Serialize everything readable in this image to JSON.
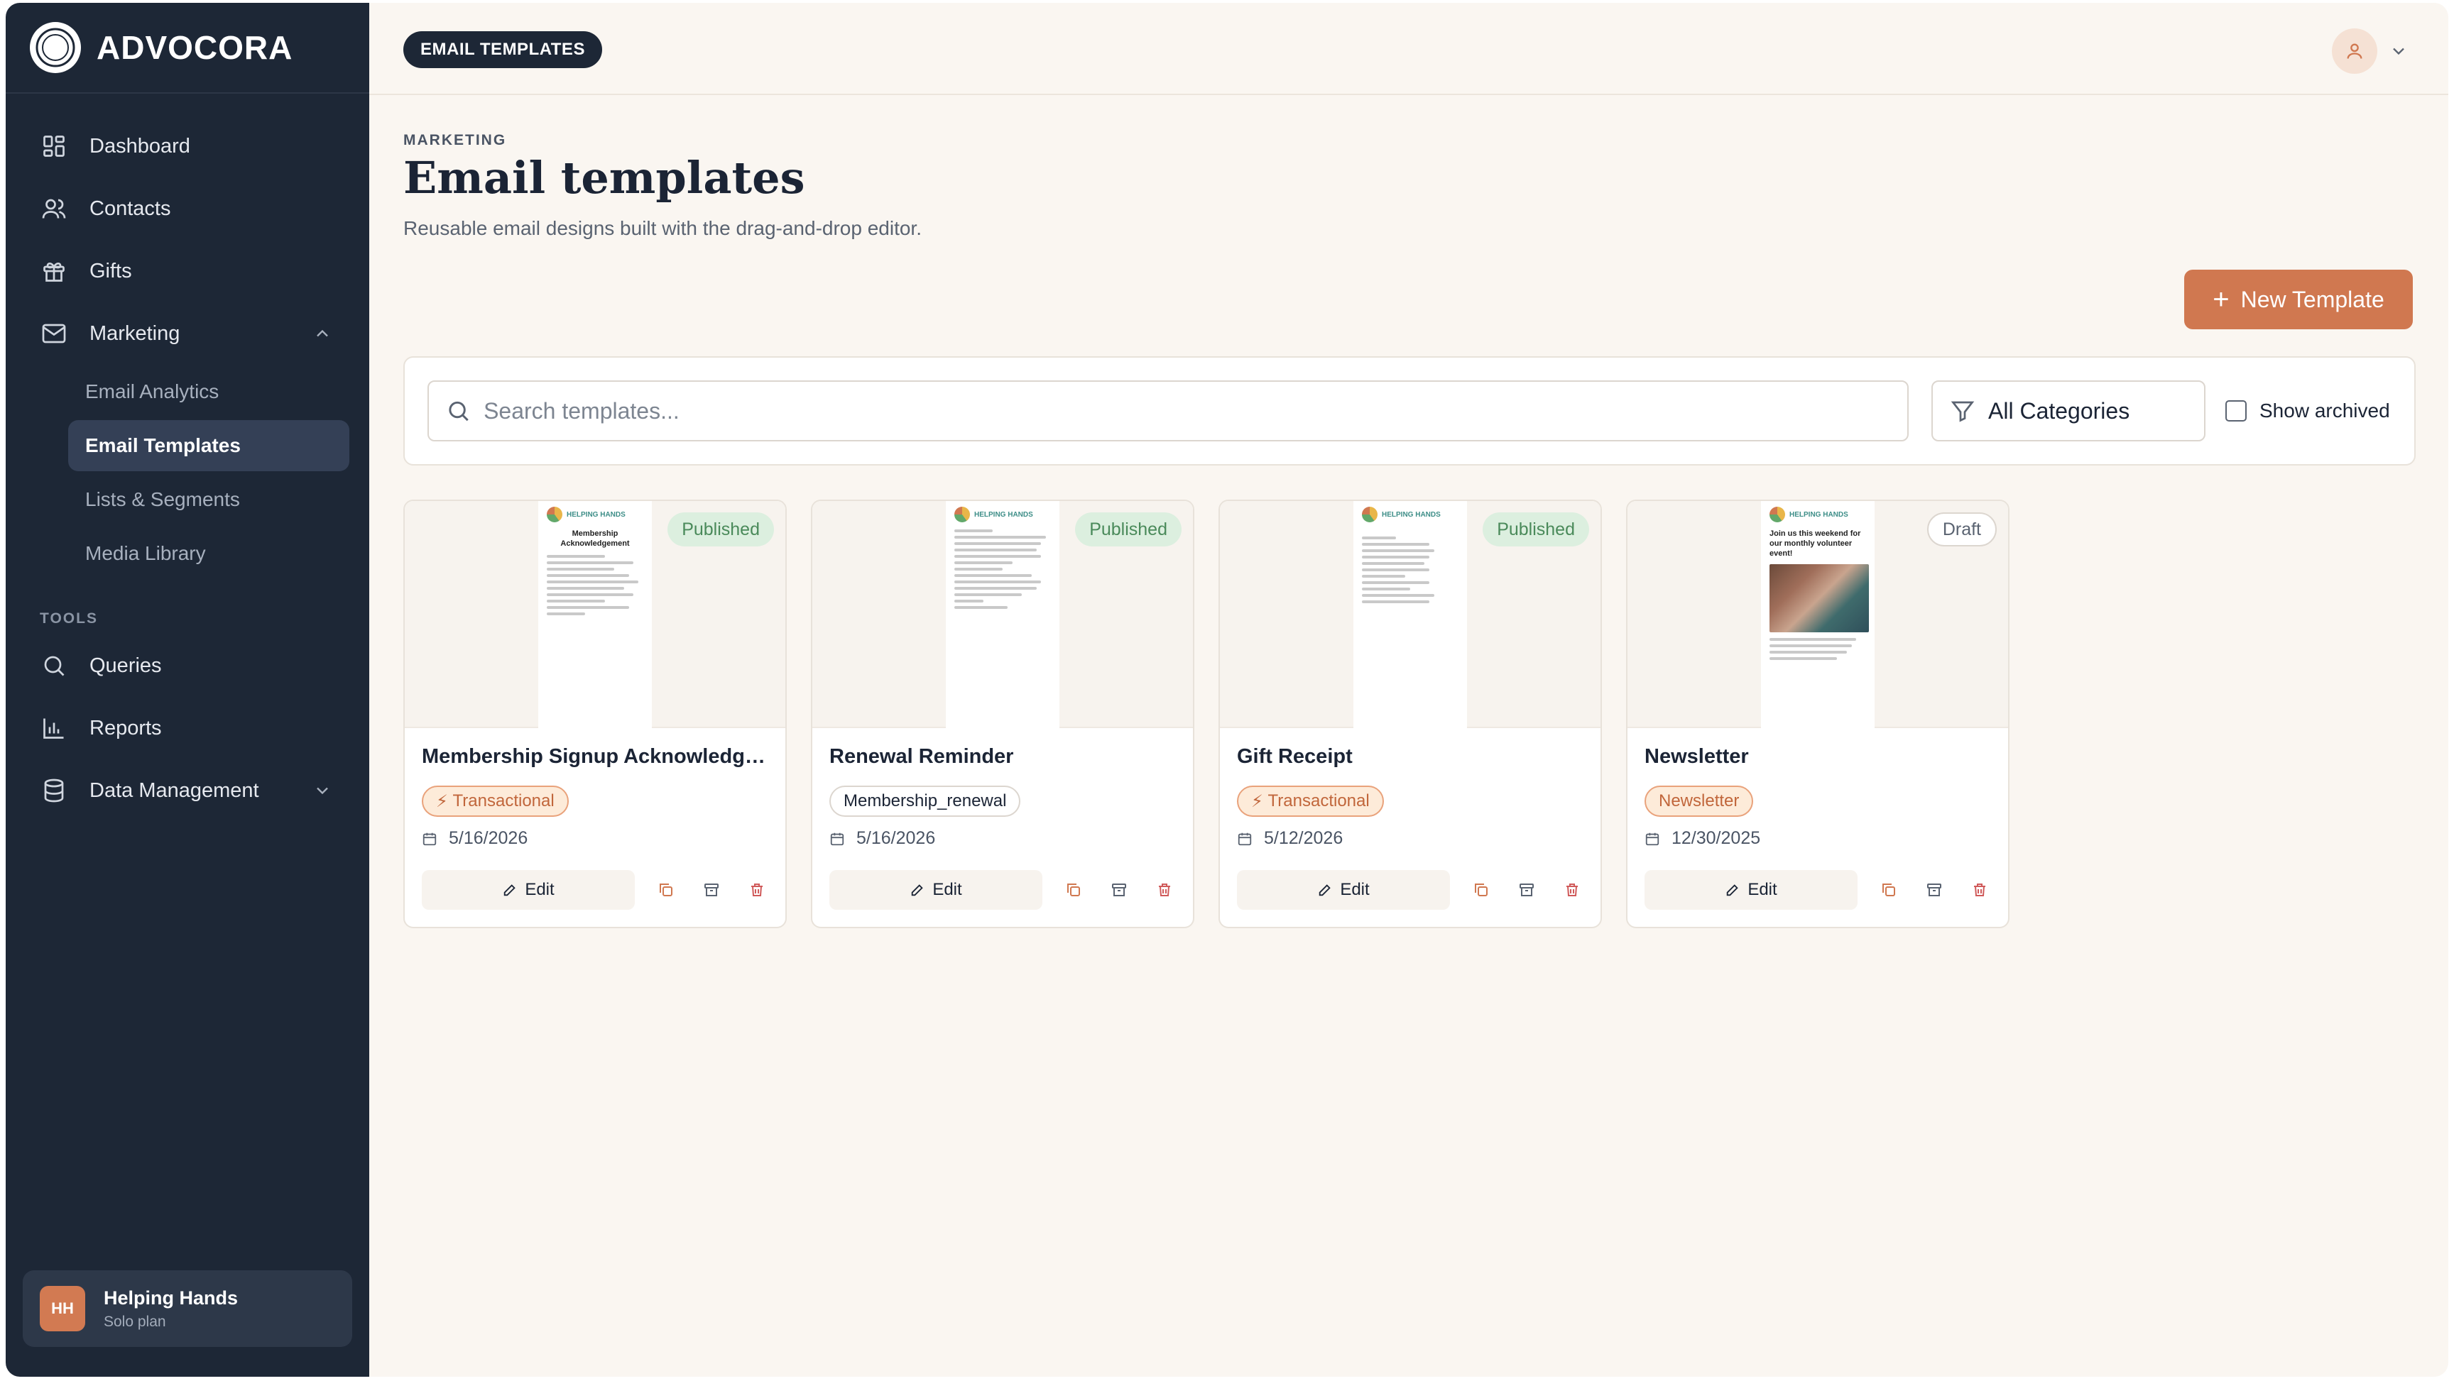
{
  "brand": {
    "name": "ADVOCORA"
  },
  "sidebar": {
    "items": [
      {
        "label": "Dashboard",
        "icon": "dashboard-icon"
      },
      {
        "label": "Contacts",
        "icon": "users-icon"
      },
      {
        "label": "Gifts",
        "icon": "gift-icon"
      },
      {
        "label": "Marketing",
        "icon": "mail-icon"
      }
    ],
    "marketing_sub": [
      {
        "label": "Email Analytics"
      },
      {
        "label": "Email Templates"
      },
      {
        "label": "Lists & Segments"
      },
      {
        "label": "Media Library"
      }
    ],
    "tools_label": "TOOLS",
    "tools": [
      {
        "label": "Queries",
        "icon": "search-icon"
      },
      {
        "label": "Reports",
        "icon": "bar-chart-icon"
      },
      {
        "label": "Data Management",
        "icon": "database-icon"
      }
    ],
    "org": {
      "initials": "HH",
      "name": "Helping Hands",
      "plan": "Solo plan"
    }
  },
  "header": {
    "breadcrumb": "EMAIL TEMPLATES"
  },
  "page": {
    "eyebrow": "MARKETING",
    "title": "Email templates",
    "description": "Reusable email designs built with the drag-and-drop editor.",
    "new_button": "New Template"
  },
  "filters": {
    "search_placeholder": "Search templates...",
    "category": "All Categories",
    "show_archived": "Show archived"
  },
  "templates": [
    {
      "title": "Membership Signup Acknowledgme...",
      "status": "Published",
      "tag": "Transactional",
      "date": "5/16/2026",
      "edit": "Edit",
      "preview": {
        "logo": "HELPING HANDS",
        "heading": "Membership Acknowledgement"
      }
    },
    {
      "title": "Renewal Reminder",
      "status": "Published",
      "tag": "Membership_renewal",
      "date": "5/16/2026",
      "edit": "Edit",
      "preview": {
        "logo": "HELPING HANDS",
        "heading": ""
      }
    },
    {
      "title": "Gift Receipt",
      "status": "Published",
      "tag": "Transactional",
      "date": "5/12/2026",
      "edit": "Edit",
      "preview": {
        "logo": "HELPING HANDS",
        "heading": ""
      }
    },
    {
      "title": "Newsletter",
      "status": "Draft",
      "tag": "Newsletter",
      "date": "12/30/2025",
      "edit": "Edit",
      "preview": {
        "logo": "HELPING HANDS",
        "heading": "Join us this weekend for our monthly volunteer event!"
      }
    }
  ],
  "colors": {
    "sidebar": "#1d2736",
    "accent": "#d07850",
    "background": "#faf6f1"
  }
}
